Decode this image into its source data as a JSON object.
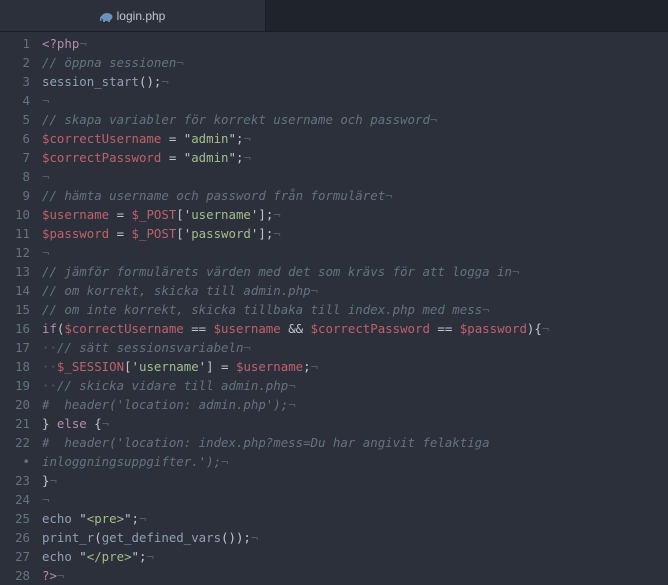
{
  "tab": {
    "filename": "login.php",
    "icon": "php-elephant-icon"
  },
  "colors": {
    "background": "#2b303b",
    "comment": "#65737e",
    "keyword": "#b48ead",
    "variable": "#bf616a",
    "string": "#a3be8c",
    "text": "#c0c5ce"
  },
  "lines": [
    {
      "num": "1",
      "tokens": [
        [
          "k",
          "<?php"
        ],
        [
          "ws",
          "¬"
        ]
      ]
    },
    {
      "num": "2",
      "tokens": [
        [
          "c",
          "// öppna sessionen"
        ],
        [
          "ws",
          "¬"
        ]
      ]
    },
    {
      "num": "3",
      "tokens": [
        [
          "f",
          "session_start"
        ],
        [
          "p",
          "();"
        ],
        [
          "ws",
          "¬"
        ]
      ]
    },
    {
      "num": "4",
      "tokens": [
        [
          "ws",
          "¬"
        ]
      ]
    },
    {
      "num": "5",
      "tokens": [
        [
          "c",
          "// skapa variabler för korrekt username och password"
        ],
        [
          "ws",
          "¬"
        ]
      ]
    },
    {
      "num": "6",
      "tokens": [
        [
          "v",
          "$correctUsername"
        ],
        [
          "p",
          " = "
        ],
        [
          "p",
          "\""
        ],
        [
          "s",
          "admin"
        ],
        [
          "p",
          "\";"
        ],
        [
          "ws",
          "¬"
        ]
      ]
    },
    {
      "num": "7",
      "tokens": [
        [
          "v",
          "$correctPassword"
        ],
        [
          "p",
          " = "
        ],
        [
          "p",
          "\""
        ],
        [
          "s",
          "admin"
        ],
        [
          "p",
          "\";"
        ],
        [
          "ws",
          "¬"
        ]
      ]
    },
    {
      "num": "8",
      "tokens": [
        [
          "ws",
          "¬"
        ]
      ]
    },
    {
      "num": "9",
      "tokens": [
        [
          "c",
          "// hämta username och password från formuläret"
        ],
        [
          "ws",
          "¬"
        ]
      ]
    },
    {
      "num": "10",
      "tokens": [
        [
          "v",
          "$username"
        ],
        [
          "p",
          " = "
        ],
        [
          "v",
          "$_POST"
        ],
        [
          "p",
          "['"
        ],
        [
          "s",
          "username"
        ],
        [
          "p",
          "'];"
        ],
        [
          "ws",
          "¬"
        ]
      ]
    },
    {
      "num": "11",
      "tokens": [
        [
          "v",
          "$password"
        ],
        [
          "p",
          " = "
        ],
        [
          "v",
          "$_POST"
        ],
        [
          "p",
          "['"
        ],
        [
          "s",
          "password"
        ],
        [
          "p",
          "'];"
        ],
        [
          "ws",
          "¬"
        ]
      ]
    },
    {
      "num": "12",
      "tokens": [
        [
          "ws",
          "¬"
        ]
      ]
    },
    {
      "num": "13",
      "tokens": [
        [
          "c",
          "// jämför formulärets värden med det som krävs för att logga in"
        ],
        [
          "ws",
          "¬"
        ]
      ]
    },
    {
      "num": "14",
      "tokens": [
        [
          "c",
          "// om korrekt, skicka till admin.php"
        ],
        [
          "ws",
          "¬"
        ]
      ]
    },
    {
      "num": "15",
      "tokens": [
        [
          "c",
          "// om inte korrekt, skicka tillbaka till index.php med mess"
        ],
        [
          "ws",
          "¬"
        ]
      ]
    },
    {
      "num": "16",
      "tokens": [
        [
          "k",
          "if"
        ],
        [
          "p",
          "("
        ],
        [
          "v",
          "$correctUsername"
        ],
        [
          "p",
          " == "
        ],
        [
          "v",
          "$username"
        ],
        [
          "p",
          " && "
        ],
        [
          "v",
          "$correctPassword"
        ],
        [
          "p",
          " == "
        ],
        [
          "v",
          "$password"
        ],
        [
          "p",
          "){"
        ],
        [
          "ws",
          "¬"
        ]
      ]
    },
    {
      "num": "17",
      "tokens": [
        [
          "ws",
          "··"
        ],
        [
          "c",
          "// sätt sessionsvariabeln"
        ],
        [
          "ws",
          "¬"
        ]
      ]
    },
    {
      "num": "18",
      "tokens": [
        [
          "ws",
          "··"
        ],
        [
          "v",
          "$_SESSION"
        ],
        [
          "p",
          "['"
        ],
        [
          "s",
          "username"
        ],
        [
          "p",
          "'] = "
        ],
        [
          "v",
          "$username"
        ],
        [
          "p",
          ";"
        ],
        [
          "ws",
          "¬"
        ]
      ]
    },
    {
      "num": "19",
      "tokens": [
        [
          "ws",
          "··"
        ],
        [
          "c",
          "// skicka vidare till admin.php"
        ],
        [
          "ws",
          "¬"
        ]
      ]
    },
    {
      "num": "20",
      "tokens": [
        [
          "c",
          "#  header('location: admin.php');"
        ],
        [
          "ws",
          "¬"
        ]
      ]
    },
    {
      "num": "21",
      "tokens": [
        [
          "p",
          "} "
        ],
        [
          "k",
          "else"
        ],
        [
          "p",
          " {"
        ],
        [
          "ws",
          "¬"
        ]
      ]
    },
    {
      "num": "22",
      "tokens": [
        [
          "c",
          "#  header('location: index.php?mess=Du har angivit felaktiga"
        ]
      ]
    },
    {
      "num": "•",
      "tokens": [
        [
          "c",
          "inloggningsuppgifter.');"
        ],
        [
          "ws",
          "¬"
        ]
      ]
    },
    {
      "num": "23",
      "tokens": [
        [
          "p",
          "}"
        ],
        [
          "ws",
          "¬"
        ]
      ]
    },
    {
      "num": "24",
      "tokens": [
        [
          "ws",
          "¬"
        ]
      ]
    },
    {
      "num": "25",
      "tokens": [
        [
          "f",
          "echo"
        ],
        [
          "p",
          " \""
        ],
        [
          "s",
          "<pre>"
        ],
        [
          "p",
          "\";"
        ],
        [
          "ws",
          "¬"
        ]
      ]
    },
    {
      "num": "26",
      "tokens": [
        [
          "f",
          "print_r"
        ],
        [
          "p",
          "("
        ],
        [
          "f",
          "get_defined_vars"
        ],
        [
          "p",
          "());"
        ],
        [
          "ws",
          "¬"
        ]
      ]
    },
    {
      "num": "27",
      "tokens": [
        [
          "f",
          "echo"
        ],
        [
          "p",
          " \""
        ],
        [
          "s",
          "</pre>"
        ],
        [
          "p",
          "\";"
        ],
        [
          "ws",
          "¬"
        ]
      ]
    },
    {
      "num": "28",
      "tokens": [
        [
          "k",
          "?>"
        ],
        [
          "ws",
          "¬"
        ]
      ]
    }
  ]
}
